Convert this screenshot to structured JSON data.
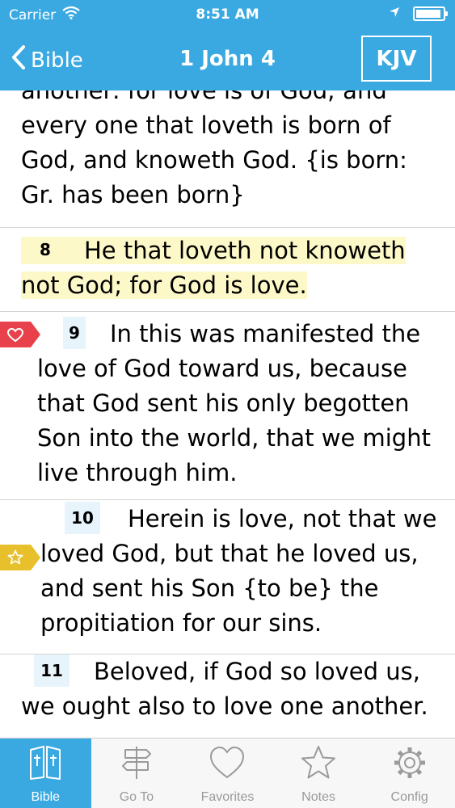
{
  "status_bar": {
    "carrier": "Carrier",
    "time": "8:51 AM",
    "battery_level": 0.95
  },
  "nav": {
    "back_label": "Bible",
    "title": "1 John 4",
    "version": "KJV"
  },
  "verses": [
    {
      "number": "",
      "text": "another: for love is of God; and every one that loveth is born of God, and knoweth God. {is born: Gr. has been born}",
      "highlight": false,
      "marker": "none"
    },
    {
      "number": "8",
      "text": "He that loveth not knoweth not God; for God is love.",
      "highlight": true,
      "marker": "none"
    },
    {
      "number": "9",
      "text": "In this was manifested the love of God toward us, because that God sent his only begotten Son into the world, that we might live through him.",
      "highlight": false,
      "marker": "heart-icon"
    },
    {
      "number": "10",
      "text": "Herein is love, not that we loved God, but that he loved us, and sent his Son {to be} the propitiation for our sins.",
      "highlight": false,
      "marker": "star-icon"
    },
    {
      "number": "11",
      "text": "Beloved, if God so loved us, we ought also to love one another.",
      "highlight": false,
      "marker": "none"
    }
  ],
  "tabs": [
    {
      "label": "Bible",
      "icon": "bible-icon",
      "active": true
    },
    {
      "label": "Go To",
      "icon": "signpost-icon",
      "active": false
    },
    {
      "label": "Favorites",
      "icon": "heart-icon",
      "active": false
    },
    {
      "label": "Notes",
      "icon": "star-icon",
      "active": false
    },
    {
      "label": "Config",
      "icon": "gear-icon",
      "active": false
    }
  ],
  "colors": {
    "primary": "#3aa9e2",
    "highlight": "#fdf8c8",
    "heart_marker": "#e8414b",
    "star_marker": "#e8c02c"
  }
}
